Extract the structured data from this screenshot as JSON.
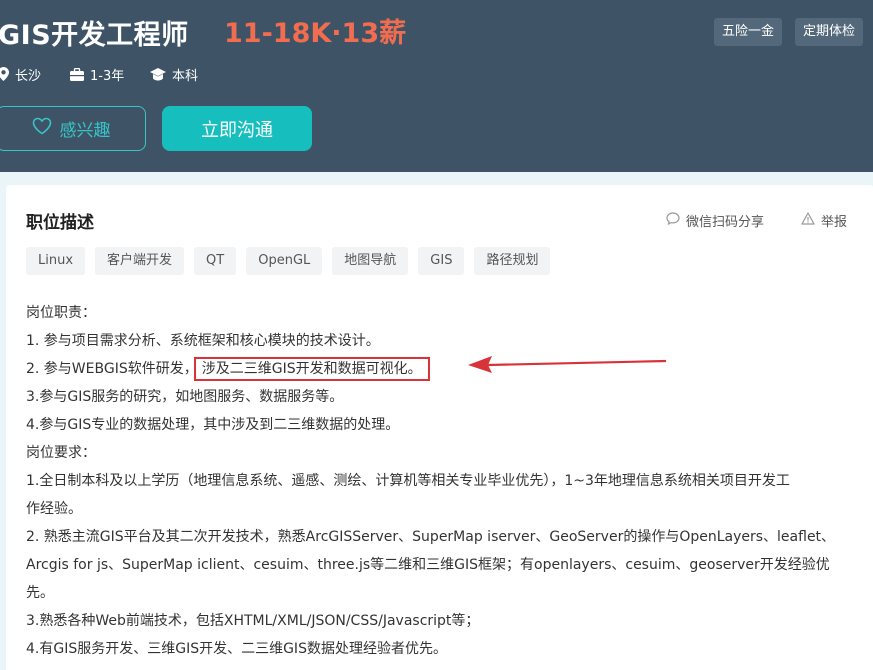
{
  "header": {
    "title": "GIS开发工程师",
    "salary": "11-18K·13薪",
    "perks": [
      "五险一金",
      "定期体检"
    ],
    "location": "长沙",
    "experience": "1-3年",
    "education": "本科",
    "interest_label": "感兴趣",
    "chat_label": "立即沟通"
  },
  "section": {
    "title": "职位描述",
    "share_label": "微信扫码分享",
    "report_label": "举报"
  },
  "tags": [
    "Linux",
    "客户端开发",
    "QT",
    "OpenGL",
    "地图导航",
    "GIS",
    "路径规划"
  ],
  "description": {
    "lines": [
      "岗位职责：",
      "1. 参与项目需求分析、系统框架和核心模块的技术设计。",
      "2. 参与WEBGIS软件研发，",
      "3.参与GIS服务的研究，如地图服务、数据服务等。",
      "4.参与GIS专业的数据处理，其中涉及到二三维数据的处理。",
      "岗位要求：",
      "1.全日制本科及以上学历（地理信息系统、遥感、测绘、计算机等相关专业毕业优先），1~3年地理信息系统相关项目开发工",
      "作经验。",
      "2. 熟悉主流GIS平台及其二次开发技术，熟悉ArcGISServer、SuperMap iserver、GeoServer的操作与OpenLayers、leaflet、",
      "Arcgis for js、SuperMap iclient、cesuim、three.js等二维和三维GIS框架；有openlayers、cesuim、geoserver开发经验优",
      "先。",
      "3.熟悉各种Web前端技术，包括XHTML/XML/JSON/CSS/Javascript等；",
      "4.有GIS服务开发、三维GIS开发、二三维GIS数据处理经验者优先。"
    ],
    "highlight": "涉及二三维GIS开发和数据可视化。"
  },
  "colors": {
    "header_bg": "#3e5466",
    "salary": "#f26d4f",
    "accent": "#17bebe",
    "highlight_red": "#d9333a"
  },
  "icons": [
    "location-pin-icon",
    "briefcase-icon",
    "graduation-cap-icon",
    "heart-icon",
    "chat-bubble-icon",
    "warning-icon"
  ]
}
